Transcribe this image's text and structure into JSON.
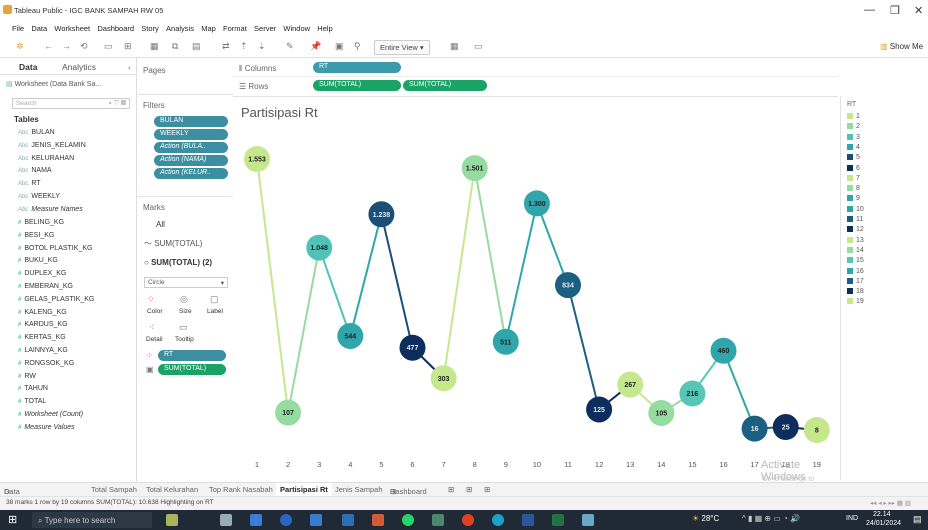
{
  "window": {
    "title": "Tableau Public - IGC BANK SAMPAH RW 05"
  },
  "menu": [
    "File",
    "Data",
    "Worksheet",
    "Dashboard",
    "Story",
    "Analysis",
    "Map",
    "Format",
    "Server",
    "Window",
    "Help"
  ],
  "toolbar": {
    "fit_mode": "Entire View",
    "show_me": "Show Me"
  },
  "left_pane": {
    "tab_data": "Data",
    "tab_analytics": "Analytics",
    "datasource": "Worksheet (Data Bank Sa...",
    "search_placeholder": "Search",
    "tables_header": "Tables",
    "dimensions": [
      "BULAN",
      "JENIS_KELAMIN",
      "KELURAHAN",
      "NAMA",
      "RT",
      "WEEKLY",
      "Measure Names"
    ],
    "measures": [
      "BELING_KG",
      "BESI_KG",
      "BOTOL PLASTIK_KG",
      "BUKU_KG",
      "DUPLEX_KG",
      "EMBERAN_KG",
      "GELAS_PLASTIK_KG",
      "KALENG_KG",
      "KARDUS_KG",
      "KERTAS_KG",
      "LAINNYA_KG",
      "RONGSOK_KG",
      "RW",
      "TAHUN",
      "TOTAL",
      "Worksheet (Count)",
      "Measure Values"
    ]
  },
  "pages": {
    "label": "Pages"
  },
  "filters": {
    "label": "Filters",
    "items": [
      "BULAN",
      "WEEKLY",
      "Action (BULA..",
      "Action (NAMA)",
      "Action (KELUR.."
    ]
  },
  "marks": {
    "label": "Marks",
    "all": "All",
    "layer1": "SUM(TOTAL)",
    "layer2": "SUM(TOTAL) (2)",
    "type": "Circle",
    "buttons": [
      "Color",
      "Size",
      "Label",
      "Detail",
      "Tooltip"
    ],
    "pill_rt": "RT",
    "pill_total": "SUM(TOTAL)"
  },
  "shelves": {
    "columns_label": "Columns",
    "rows_label": "Rows",
    "columns_pill": "RT",
    "rows_pill_1": "SUM(TOTAL)",
    "rows_pill_2": "SUM(TOTAL)"
  },
  "sheet": {
    "title": "Partisipasi Rt"
  },
  "legend": {
    "title": "RT"
  },
  "chart_data": {
    "type": "line",
    "title": "Partisipasi Rt",
    "categories": [
      "1",
      "2",
      "3",
      "4",
      "5",
      "6",
      "7",
      "8",
      "9",
      "10",
      "11",
      "12",
      "13",
      "14",
      "15",
      "16",
      "17",
      "18",
      "19"
    ],
    "values": [
      1553,
      107,
      1048,
      544,
      1238,
      477,
      303,
      1501,
      511,
      1300,
      834,
      125,
      267,
      105,
      216,
      460,
      16,
      25,
      8
    ],
    "labels": [
      "1.553",
      "107",
      "1.048",
      "544",
      "1.238",
      "477",
      "303",
      "1.501",
      "511",
      "1.300",
      "834",
      "125",
      "267",
      "105",
      "216",
      "460",
      "16",
      "25",
      "8"
    ],
    "colors": [
      "#c5e88d",
      "#96dba0",
      "#4fc4b6",
      "#2fa6ab",
      "#1b4f78",
      "#0d2e5c",
      "#c5e88d",
      "#96dba0",
      "#2fa6ab",
      "#2fa6ab",
      "#1b5f82",
      "#0d2e5c",
      "#c5e88d",
      "#96dba0",
      "#58c6b5",
      "#2fa6ab",
      "#1b5f82",
      "#0d2e5c",
      "#c5e88d"
    ],
    "legend": [
      "1",
      "2",
      "3",
      "4",
      "5",
      "6",
      "7",
      "8",
      "9",
      "10",
      "11",
      "12",
      "13",
      "14",
      "15",
      "16",
      "17",
      "18",
      "19"
    ]
  },
  "bottom_tabs": [
    "Data Source",
    "Total Sampah",
    "Total Kelurahan",
    "Top Rank Nasabah",
    "Partisipasi Rt",
    "Jenis Sampah",
    "Dashboard 1"
  ],
  "status": {
    "text": "38 marks   1 row by 19 columns   SUM(TOTAL): 10.638   Highlighting on RT"
  },
  "taskbar": {
    "search_placeholder": "Type here to search",
    "weather": "28°C",
    "lang": "IND",
    "time": "22.14",
    "date": "24/01/2024"
  },
  "watermark": {
    "line1": "Activate Windows",
    "line2": "Go to Settings to activate Windows."
  }
}
